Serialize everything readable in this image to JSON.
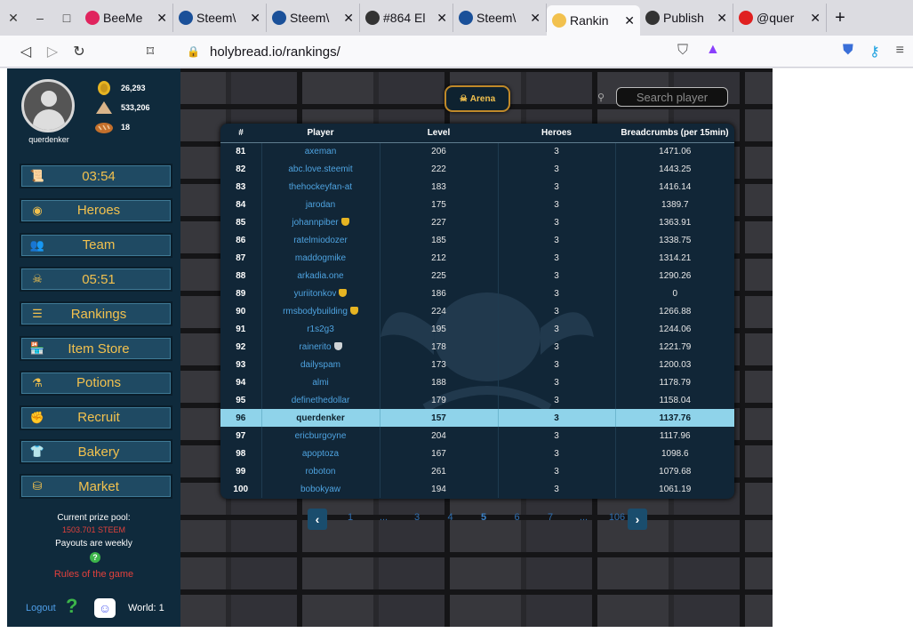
{
  "browser": {
    "tabs": [
      {
        "title": "BeeMe",
        "favicon_color": "#e0245e",
        "favicon": "bee-icon"
      },
      {
        "title": "Steem\\",
        "favicon_color": "#1a5099",
        "favicon": "steem-icon"
      },
      {
        "title": "Steem\\",
        "favicon_color": "#1a5099",
        "favicon": "steem-icon"
      },
      {
        "title": "#864 El",
        "favicon_color": "#333333",
        "favicon": "mountain-icon"
      },
      {
        "title": "Steem\\",
        "favicon_color": "#1a5099",
        "favicon": "steem-icon"
      },
      {
        "title": "Rankin",
        "favicon_color": "#f2c14e",
        "favicon": "holybread-icon",
        "active": true
      },
      {
        "title": "Publish",
        "favicon_color": "#333333",
        "favicon": "mountain-icon"
      },
      {
        "title": "@quer",
        "favicon_color": "#e02020",
        "favicon": "hive-icon"
      }
    ],
    "url": "holybread.io/rankings/"
  },
  "sidebar": {
    "username": "querdenker",
    "resources": [
      {
        "name": "gold-coin-icon",
        "value": "26,293"
      },
      {
        "name": "flour-icon",
        "value": "533,206"
      },
      {
        "name": "bread-icon",
        "value": "18"
      }
    ],
    "menu": [
      {
        "icon": "quest-icon",
        "glyph": "📜",
        "label": "03:54"
      },
      {
        "icon": "mask-icon",
        "glyph": "◉",
        "label": "Heroes"
      },
      {
        "icon": "team-icon",
        "glyph": "👥",
        "label": "Team"
      },
      {
        "icon": "skull-icon",
        "glyph": "☠",
        "label": "05:51"
      },
      {
        "icon": "list-icon",
        "glyph": "☰",
        "label": "Rankings"
      },
      {
        "icon": "store-icon",
        "glyph": "🏪",
        "label": "Item Store"
      },
      {
        "icon": "potion-icon",
        "glyph": "⚗",
        "label": "Potions"
      },
      {
        "icon": "fist-icon",
        "glyph": "✊",
        "label": "Recruit"
      },
      {
        "icon": "chef-hat-icon",
        "glyph": "👕",
        "label": "Bakery"
      },
      {
        "icon": "coins-icon",
        "glyph": "⛁",
        "label": "Market"
      }
    ],
    "prize_pool_label": "Current prize pool:",
    "prize_pool_value": "1503.701 STEEM",
    "payouts_label": "Payouts are weekly",
    "rules_label": "Rules of the game",
    "logout_label": "Logout",
    "world_label": "World: 1"
  },
  "top": {
    "arena_label": "Arena",
    "search_placeholder": "Search player"
  },
  "table": {
    "headers": [
      "#",
      "Player",
      "Level",
      "Heroes",
      "Breadcrumbs (per 15min)"
    ],
    "rows": [
      {
        "rank": "81",
        "player": "axeman",
        "level": "206",
        "heroes": "3",
        "bc": "1471.06"
      },
      {
        "rank": "82",
        "player": "abc.love.steemit",
        "level": "222",
        "heroes": "3",
        "bc": "1443.25"
      },
      {
        "rank": "83",
        "player": "thehockeyfan-at",
        "level": "183",
        "heroes": "3",
        "bc": "1416.14"
      },
      {
        "rank": "84",
        "player": "jarodan",
        "level": "175",
        "heroes": "3",
        "bc": "1389.7"
      },
      {
        "rank": "85",
        "player": "johannpiber",
        "badge": "gold",
        "level": "227",
        "heroes": "3",
        "bc": "1363.91"
      },
      {
        "rank": "86",
        "player": "ratelmiodozer",
        "level": "185",
        "heroes": "3",
        "bc": "1338.75"
      },
      {
        "rank": "87",
        "player": "maddogmike",
        "level": "212",
        "heroes": "3",
        "bc": "1314.21"
      },
      {
        "rank": "88",
        "player": "arkadia.one",
        "level": "225",
        "heroes": "3",
        "bc": "1290.26"
      },
      {
        "rank": "89",
        "player": "yuriitonkov",
        "badge": "gold",
        "level": "186",
        "heroes": "3",
        "bc": "0"
      },
      {
        "rank": "90",
        "player": "rmsbodybuilding",
        "badge": "gold",
        "level": "224",
        "heroes": "3",
        "bc": "1266.88"
      },
      {
        "rank": "91",
        "player": "r1s2g3",
        "level": "195",
        "heroes": "3",
        "bc": "1244.06"
      },
      {
        "rank": "92",
        "player": "rainerito",
        "badge": "silver",
        "level": "178",
        "heroes": "3",
        "bc": "1221.79"
      },
      {
        "rank": "93",
        "player": "dailyspam",
        "level": "173",
        "heroes": "3",
        "bc": "1200.03"
      },
      {
        "rank": "94",
        "player": "almi",
        "level": "188",
        "heroes": "3",
        "bc": "1178.79"
      },
      {
        "rank": "95",
        "player": "definethedollar",
        "level": "179",
        "heroes": "3",
        "bc": "1158.04"
      },
      {
        "rank": "96",
        "player": "querdenker",
        "level": "157",
        "heroes": "3",
        "bc": "1137.76",
        "me": true
      },
      {
        "rank": "97",
        "player": "ericburgoyne",
        "level": "204",
        "heroes": "3",
        "bc": "1117.96"
      },
      {
        "rank": "98",
        "player": "apoptoza",
        "level": "167",
        "heroes": "3",
        "bc": "1098.6"
      },
      {
        "rank": "99",
        "player": "roboton",
        "level": "261",
        "heroes": "3",
        "bc": "1079.68"
      },
      {
        "rank": "100",
        "player": "bobokyaw",
        "level": "194",
        "heroes": "3",
        "bc": "1061.19"
      }
    ]
  },
  "pagination": {
    "items": [
      "1",
      "...",
      "3",
      "4",
      "5",
      "6",
      "7",
      "...",
      "106"
    ],
    "current": "5"
  },
  "colors": {
    "accent_gold": "#f2c14e",
    "sidebar_bg": "#0f2a3c",
    "highlight_row": "#8fd3ea",
    "link_blue": "#4ea3e0"
  }
}
